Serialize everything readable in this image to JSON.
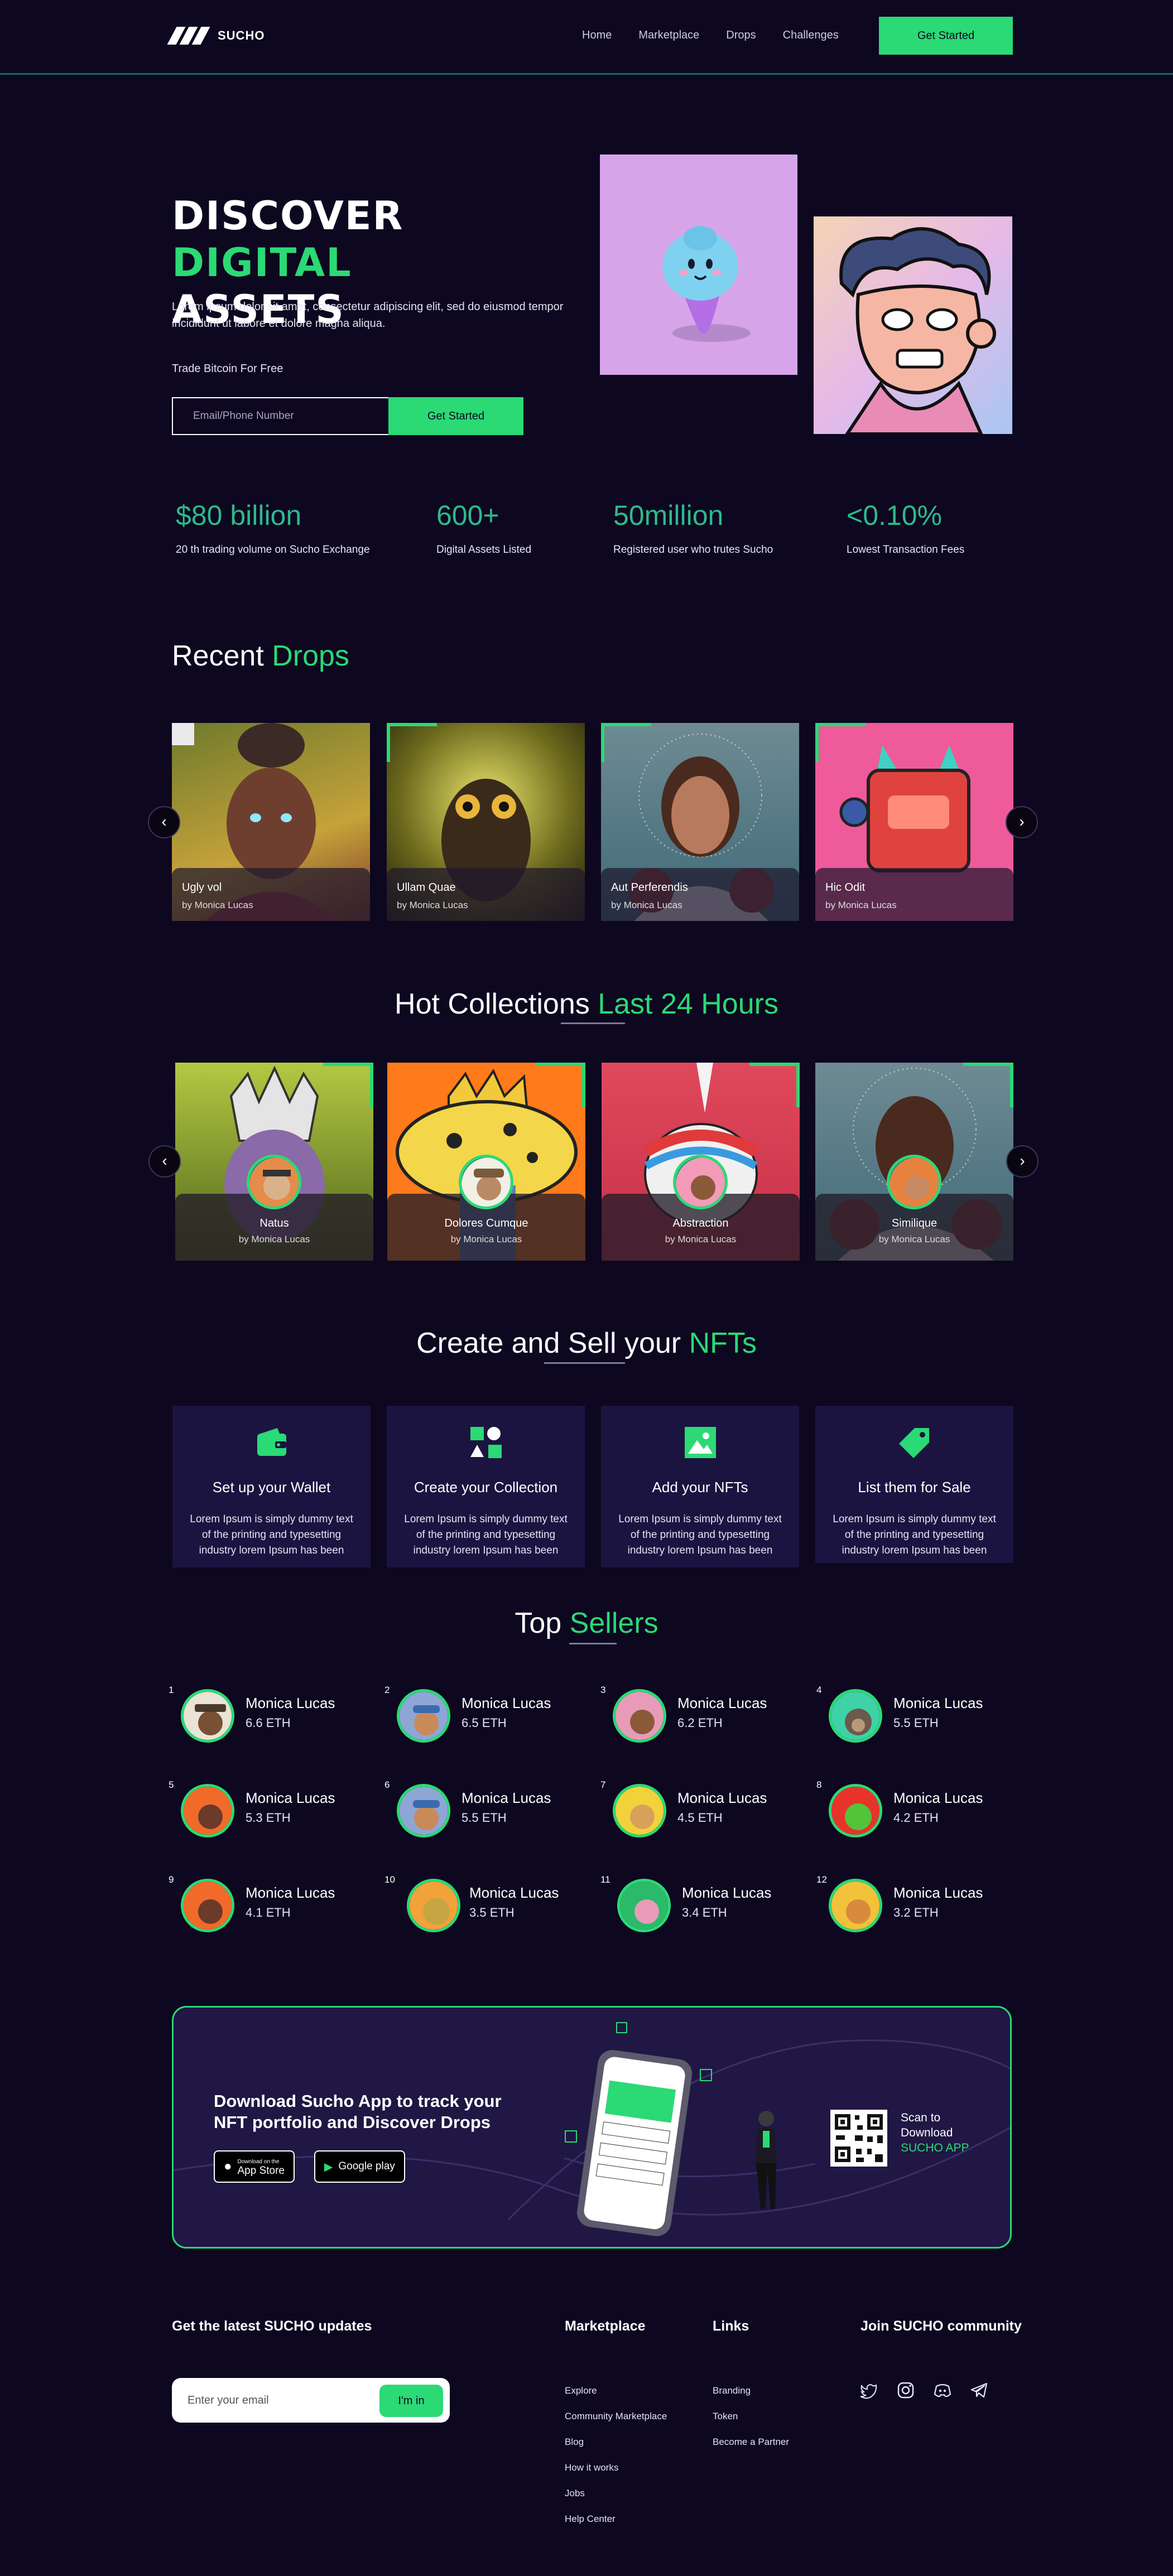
{
  "brand": {
    "name": "SUCHO"
  },
  "nav": {
    "items": [
      "Home",
      "Marketplace",
      "Drops",
      "Challenges"
    ],
    "cta": "Get Started"
  },
  "hero": {
    "title_word1": "DISCOVER",
    "title_word2": "DIGITAL",
    "title_word3": "ASSETS",
    "subtitle": "Lorem ipsum dolor sit amet, consectetur adipiscing elit, sed do eiusmod tempor incididunt ut labore et dolore magna aliqua.",
    "small": "Trade Bitcoin For Free",
    "input_placeholder": "Email/Phone Number",
    "cta": "Get Started"
  },
  "stats": [
    {
      "value": "$80 billion",
      "label": "20 th trading volume on Sucho Exchange"
    },
    {
      "value": "600+",
      "label": "Digital Assets Listed"
    },
    {
      "value": "50million",
      "label": "Registered user who trutes Sucho"
    },
    {
      "value": "<0.10%",
      "label": "Lowest Transaction Fees"
    }
  ],
  "recent": {
    "title_a": "Recent",
    "title_b": "Drops",
    "cards": [
      {
        "title": "Ugly vol",
        "by": "by Monica Lucas"
      },
      {
        "title": "Ullam Quae",
        "by": "by Monica Lucas"
      },
      {
        "title": "Aut Perferendis",
        "by": "by Monica Lucas"
      },
      {
        "title": "Hic Odit",
        "by": "by Monica Lucas"
      }
    ],
    "prev": "‹",
    "next": "›"
  },
  "hot": {
    "title_a": "Hot Collections",
    "title_b": "Last 24 Hours",
    "cards": [
      {
        "title": "Natus",
        "by": "by Monica Lucas"
      },
      {
        "title": "Dolores Cumque",
        "by": "by Monica Lucas"
      },
      {
        "title": "Abstraction",
        "by": "by Monica Lucas"
      },
      {
        "title": "Similique",
        "by": "by Monica Lucas"
      }
    ],
    "prev": "‹",
    "next": "›"
  },
  "create": {
    "title_a": "Create and Sell your",
    "title_b": "NFTs",
    "steps": [
      {
        "icon": "wallet-icon",
        "title": "Set up your Wallet",
        "desc": "Lorem Ipsum is simply dummy text of the printing and typesetting industry lorem Ipsum has been"
      },
      {
        "icon": "collection-shapes-icon",
        "title": "Create your Collection",
        "desc": "Lorem Ipsum is simply dummy text of the printing and typesetting industry lorem Ipsum has been"
      },
      {
        "icon": "image-icon",
        "title": "Add your NFTs",
        "desc": "Lorem Ipsum is simply dummy text of the printing and typesetting industry lorem Ipsum has been"
      },
      {
        "icon": "tag-icon",
        "title": "List them for Sale",
        "desc": "Lorem Ipsum is simply dummy text of the printing and typesetting industry lorem Ipsum has been"
      }
    ]
  },
  "sellers": {
    "title_a": "Top",
    "title_b": "Sellers",
    "list": [
      {
        "rank": "1",
        "name": "Monica Lucas",
        "eth": "6.6 ETH"
      },
      {
        "rank": "2",
        "name": "Monica Lucas",
        "eth": "6.5 ETH"
      },
      {
        "rank": "3",
        "name": "Monica Lucas",
        "eth": "6.2 ETH"
      },
      {
        "rank": "4",
        "name": "Monica Lucas",
        "eth": "5.5 ETH"
      },
      {
        "rank": "5",
        "name": "Monica Lucas",
        "eth": "5.3 ETH"
      },
      {
        "rank": "6",
        "name": "Monica Lucas",
        "eth": "5.5 ETH"
      },
      {
        "rank": "7",
        "name": "Monica Lucas",
        "eth": "4.5 ETH"
      },
      {
        "rank": "8",
        "name": "Monica Lucas",
        "eth": "4.2 ETH"
      },
      {
        "rank": "9",
        "name": "Monica Lucas",
        "eth": "4.1 ETH"
      },
      {
        "rank": "10",
        "name": "Monica Lucas",
        "eth": "3.5 ETH"
      },
      {
        "rank": "11",
        "name": "Monica Lucas",
        "eth": "3.4 ETH"
      },
      {
        "rank": "12",
        "name": "Monica Lucas",
        "eth": "3.2 ETH"
      }
    ]
  },
  "app": {
    "title": "Download Sucho App to track your NFT portfolio and Discover Drops",
    "appstore_small": "Download on the",
    "appstore": "App Store",
    "googleplay": "Google play",
    "scan_1": "Scan to",
    "scan_2": "Download",
    "scan_3": "SUCHO APP"
  },
  "footer": {
    "newsletter_title": "Get the latest SUCHO updates",
    "newsletter_placeholder": "Enter your email",
    "newsletter_btn": "I'm in",
    "marketplace_title": "Marketplace",
    "marketplace_links": [
      "Explore",
      "Community Marketplace",
      "Blog",
      "How it works",
      "Jobs",
      "Help Center"
    ],
    "links_title": "Links",
    "links": [
      "Branding",
      "Token",
      "Become a Partner"
    ],
    "community_title": "Join SUCHO community",
    "social": [
      "twitter-icon",
      "instagram-icon",
      "discord-icon",
      "telegram-icon"
    ]
  },
  "colors": {
    "background": "#0d0720",
    "accent": "#2bd975",
    "panel": "#1b1440"
  }
}
